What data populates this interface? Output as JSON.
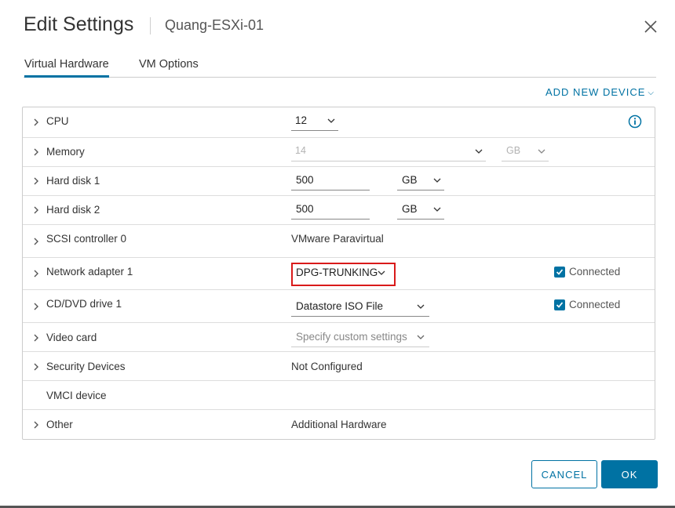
{
  "header": {
    "title": "Edit Settings",
    "subtitle": "Quang-ESXi-01"
  },
  "tabs": [
    {
      "label": "Virtual Hardware"
    },
    {
      "label": "VM Options"
    }
  ],
  "add_device_label": "ADD NEW DEVICE",
  "rows": {
    "cpu": {
      "label": "CPU",
      "value": "12"
    },
    "memory": {
      "label": "Memory",
      "value": "14",
      "unit": "GB"
    },
    "hard_disk_1": {
      "label": "Hard disk 1",
      "value": "500",
      "unit": "GB"
    },
    "hard_disk_2": {
      "label": "Hard disk 2",
      "value": "500",
      "unit": "GB"
    },
    "scsi": {
      "label": "SCSI controller 0",
      "value": "VMware Paravirtual"
    },
    "network": {
      "label": "Network adapter 1",
      "value": "DPG-TRUNKING",
      "connected_label": "Connected",
      "connected": true
    },
    "cddvd": {
      "label": "CD/DVD drive 1",
      "value": "Datastore ISO File",
      "connected_label": "Connected",
      "connected": true
    },
    "video": {
      "label": "Video card",
      "value": "Specify custom settings"
    },
    "security": {
      "label": "Security Devices",
      "value": "Not Configured"
    },
    "vmci": {
      "label": "VMCI device"
    },
    "other": {
      "label": "Other",
      "value": "Additional Hardware"
    }
  },
  "buttons": {
    "cancel": "CANCEL",
    "ok": "OK"
  },
  "colors": {
    "accent": "#0072a3",
    "highlight": "#d91a1a"
  },
  "icons": {
    "close": "close-icon",
    "info": "info-icon",
    "expand": "chevron-right-icon",
    "dropdown": "chevron-down-icon",
    "checkbox": "checkbox-checked-icon"
  }
}
